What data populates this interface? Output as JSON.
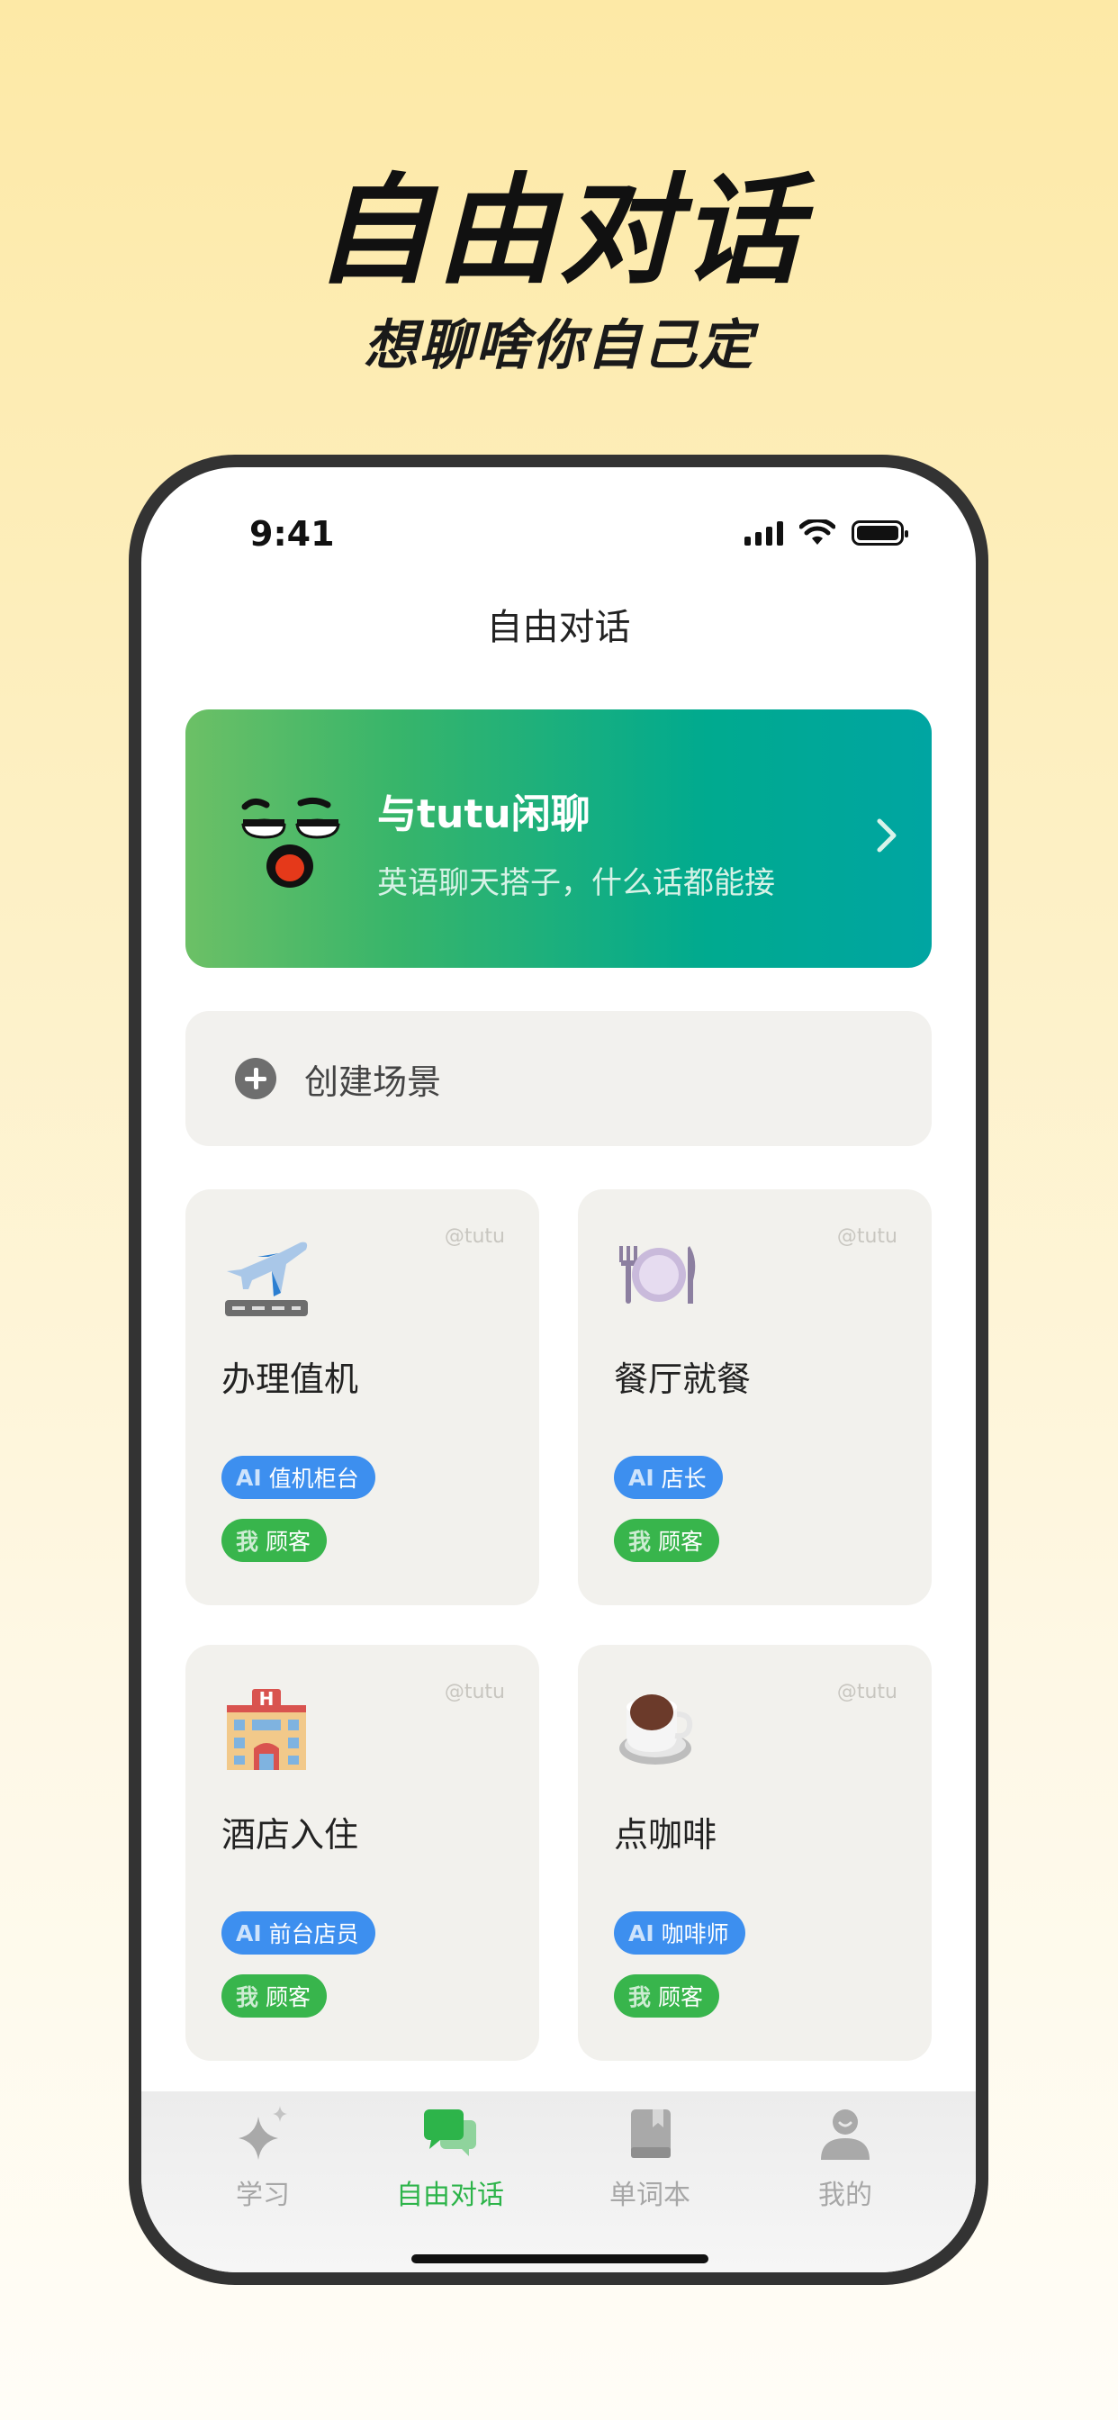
{
  "hero": {
    "title": "自由对话",
    "subtitle": "想聊啥你自己定"
  },
  "status_bar": {
    "time": "9:41"
  },
  "nav": {
    "title": "自由对话"
  },
  "chat_card": {
    "title": "与tutu闲聊",
    "subtitle": "英语聊天搭子，什么话都能接"
  },
  "create_scene": {
    "label": "创建场景"
  },
  "scenes": [
    {
      "name": "办理值机",
      "author": "@tutu",
      "ai_prefix": "AI",
      "ai_role": "值机柜台",
      "me_prefix": "我",
      "me_role": "顾客",
      "icon": "airplane-icon"
    },
    {
      "name": "餐厅就餐",
      "author": "@tutu",
      "ai_prefix": "AI",
      "ai_role": "店长",
      "me_prefix": "我",
      "me_role": "顾客",
      "icon": "plate-icon"
    },
    {
      "name": "酒店入住",
      "author": "@tutu",
      "ai_prefix": "AI",
      "ai_role": "前台店员",
      "me_prefix": "我",
      "me_role": "顾客",
      "icon": "hotel-icon"
    },
    {
      "name": "点咖啡",
      "author": "@tutu",
      "ai_prefix": "AI",
      "ai_role": "咖啡师",
      "me_prefix": "我",
      "me_role": "顾客",
      "icon": "coffee-icon"
    }
  ],
  "tabs": [
    {
      "label": "学习",
      "icon": "sparkle-icon"
    },
    {
      "label": "自由对话",
      "icon": "chat-bubbles-icon",
      "active": true
    },
    {
      "label": "单词本",
      "icon": "book-icon"
    },
    {
      "label": "我的",
      "icon": "user-icon"
    }
  ],
  "colors": {
    "accent_green": "#2db44a",
    "ai_blue": "#3d8fef",
    "me_green": "#38b54c"
  }
}
